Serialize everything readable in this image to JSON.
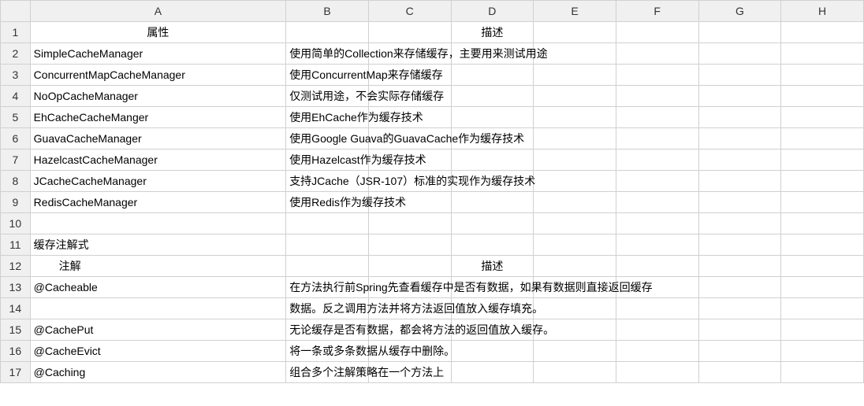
{
  "columns": [
    "A",
    "B",
    "C",
    "D",
    "E",
    "F",
    "G",
    "H"
  ],
  "rowCount": 17,
  "header1": {
    "a": "属性",
    "desc": "描述"
  },
  "rows1": [
    {
      "a": "SimpleCacheManager",
      "b": "使用简单的Collection来存储缓存，主要用来测试用途"
    },
    {
      "a": "ConcurrentMapCacheManager",
      "b": "使用ConcurrentMap来存储缓存"
    },
    {
      "a": "NoOpCacheManager",
      "b": "仅测试用途，不会实际存储缓存"
    },
    {
      "a": "EhCacheCacheManger",
      "b": "使用EhCache作为缓存技术"
    },
    {
      "a": "GuavaCacheManager",
      "b": "使用Google Guava的GuavaCache作为缓存技术"
    },
    {
      "a": "HazelcastCacheManager",
      "b": "使用Hazelcast作为缓存技术"
    },
    {
      "a": "JCacheCacheManager",
      "b": "支持JCache（JSR-107）标准的实现作为缓存技术"
    },
    {
      "a": "RedisCacheManager",
      "b": "使用Redis作为缓存技术"
    }
  ],
  "section2": "缓存注解式",
  "header2": {
    "a": "注解",
    "desc": "描述"
  },
  "rows2": [
    {
      "a": "@Cacheable",
      "b": "在方法执行前Spring先查看缓存中是否有数据，如果有数据则直接返回缓存"
    },
    {
      "a": "",
      "b": "数据。反之调用方法并将方法返回值放入缓存填充。"
    },
    {
      "a": "@CachePut",
      "b": "无论缓存是否有数据，都会将方法的返回值放入缓存。"
    },
    {
      "a": "@CacheEvict",
      "b": "将一条或多条数据从缓存中删除。"
    },
    {
      "a": "@Caching",
      "b": "组合多个注解策略在一个方法上"
    }
  ]
}
